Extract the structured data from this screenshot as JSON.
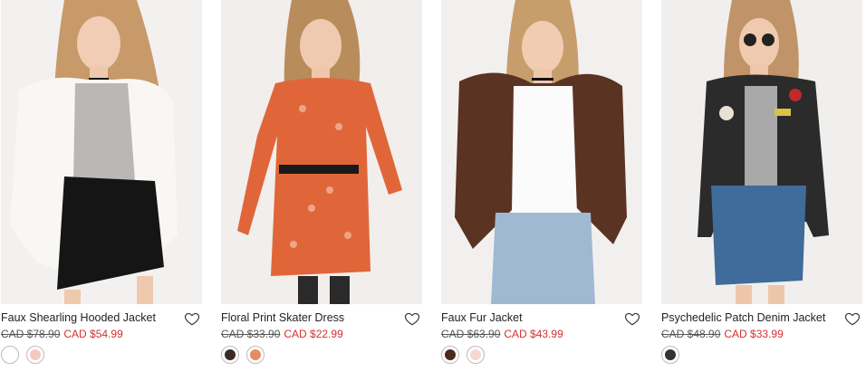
{
  "products": [
    {
      "name": "Faux Shearling Hooded Jacket",
      "old_price": "CAD $78.90",
      "sale_price": "CAD $54.99",
      "swatches": [
        "#ffffff",
        "#f6c9c0"
      ]
    },
    {
      "name": "Floral Print Skater Dress",
      "old_price": "CAD $33.90",
      "sale_price": "CAD $22.99",
      "swatches": [
        "#3a2b22",
        "#e88a63"
      ]
    },
    {
      "name": "Faux Fur Jacket",
      "old_price": "CAD $63.90",
      "sale_price": "CAD $43.99",
      "swatches": [
        "#4a2a1c",
        "#f6d8cf"
      ]
    },
    {
      "name": "Psychedelic Patch Denim Jacket",
      "old_price": "CAD $48.90",
      "sale_price": "CAD $33.99",
      "swatches": [
        "#333333"
      ]
    }
  ],
  "icons": {
    "wishlist": "heart-icon"
  },
  "colors": {
    "sale": "#d3312e",
    "text": "#222222"
  }
}
